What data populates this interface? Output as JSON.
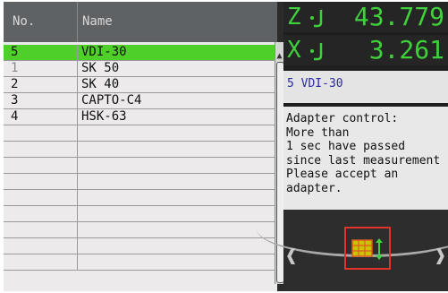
{
  "table": {
    "headers": {
      "no": "No.",
      "name": "Name"
    },
    "rows": [
      {
        "no": "5",
        "name": "VDI-30",
        "selected": true
      },
      {
        "no": "1",
        "name": "SK 50",
        "dim": true
      },
      {
        "no": "2",
        "name": "SK 40"
      },
      {
        "no": "3",
        "name": "CAPTO-C4"
      },
      {
        "no": "4",
        "name": "HSK-63"
      },
      {
        "no": "",
        "name": ""
      },
      {
        "no": "",
        "name": ""
      },
      {
        "no": "",
        "name": ""
      },
      {
        "no": "",
        "name": ""
      },
      {
        "no": "",
        "name": ""
      },
      {
        "no": "",
        "name": ""
      },
      {
        "no": "",
        "name": ""
      },
      {
        "no": "",
        "name": ""
      },
      {
        "no": "",
        "name": ""
      }
    ]
  },
  "axes": {
    "z": {
      "label": "Z",
      "value": "43.779"
    },
    "x": {
      "label": "X",
      "value": "3.261"
    }
  },
  "tool_info": "5  VDI-30",
  "message": "Adapter control:\nMore than\n1 sec have passed\nsince last measurement\nPlease accept an\nadapter.",
  "colors": {
    "selected_row": "#4fcf2a",
    "axis_green": "#3fd13a",
    "button_border": "#e2332a"
  },
  "icons": {
    "axis": "probe-icon",
    "accept": "table-adjust-icon",
    "left": "chevron-left-icon",
    "right": "chevron-right-icon"
  }
}
